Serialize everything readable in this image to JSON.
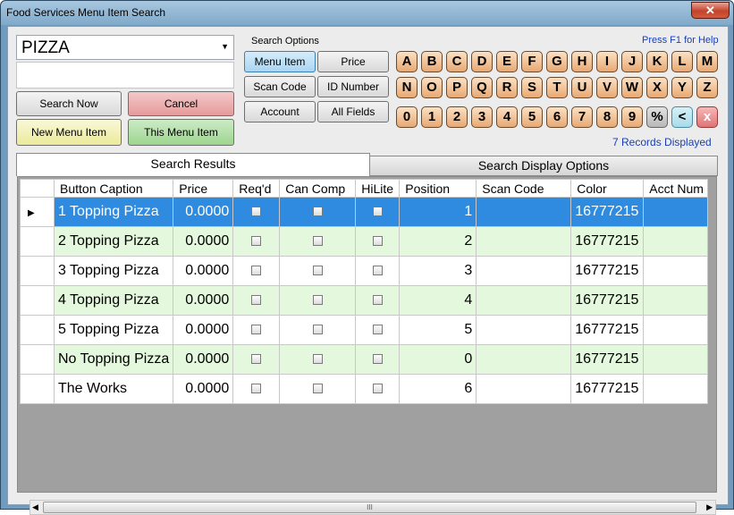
{
  "window": {
    "title": "Food Services Menu Item Search"
  },
  "search": {
    "value": "PIZZA"
  },
  "buttons": {
    "search_now": "Search Now",
    "cancel": "Cancel",
    "new_menu_item": "New Menu Item",
    "this_menu_item": "This Menu Item"
  },
  "options": {
    "title": "Search Options",
    "menu_item": "Menu Item",
    "price": "Price",
    "scan_code": "Scan Code",
    "id_number": "ID Number",
    "account": "Account",
    "all_fields": "All Fields"
  },
  "keyboard": {
    "row1": [
      "A",
      "B",
      "C",
      "D",
      "E",
      "F",
      "G",
      "H",
      "I",
      "J",
      "K",
      "L",
      "M"
    ],
    "row2": [
      "N",
      "O",
      "P",
      "Q",
      "R",
      "S",
      "T",
      "U",
      "V",
      "W",
      "X",
      "Y",
      "Z"
    ],
    "row3": [
      "0",
      "1",
      "2",
      "3",
      "4",
      "5",
      "6",
      "7",
      "8",
      "9",
      "%",
      "<",
      "x"
    ]
  },
  "help_text": "Press F1 for Help",
  "records_text": "7 Records Displayed",
  "tabs": {
    "results": "Search Results",
    "display_options": "Search Display Options"
  },
  "grid": {
    "columns": [
      "Button Caption",
      "Price",
      "Req'd",
      "Can Comp",
      "HiLite",
      "Position",
      "Scan Code",
      "Color",
      "Acct Num"
    ],
    "rows": [
      {
        "caption": "1 Topping Pizza",
        "price": "0.0000",
        "position": "1",
        "color": "16777215"
      },
      {
        "caption": "2 Topping Pizza",
        "price": "0.0000",
        "position": "2",
        "color": "16777215"
      },
      {
        "caption": "3 Topping Pizza",
        "price": "0.0000",
        "position": "3",
        "color": "16777215"
      },
      {
        "caption": "4 Topping Pizza",
        "price": "0.0000",
        "position": "4",
        "color": "16777215"
      },
      {
        "caption": "5 Topping Pizza",
        "price": "0.0000",
        "position": "5",
        "color": "16777215"
      },
      {
        "caption": "No Topping Pizza",
        "price": "0.0000",
        "position": "0",
        "color": "16777215"
      },
      {
        "caption": "The Works",
        "price": "0.0000",
        "position": "6",
        "color": "16777215"
      }
    ]
  },
  "colors": {
    "selection": "#2e8be0",
    "alt_row": "#e3f8dc",
    "help_link": "#1a3fb5"
  }
}
